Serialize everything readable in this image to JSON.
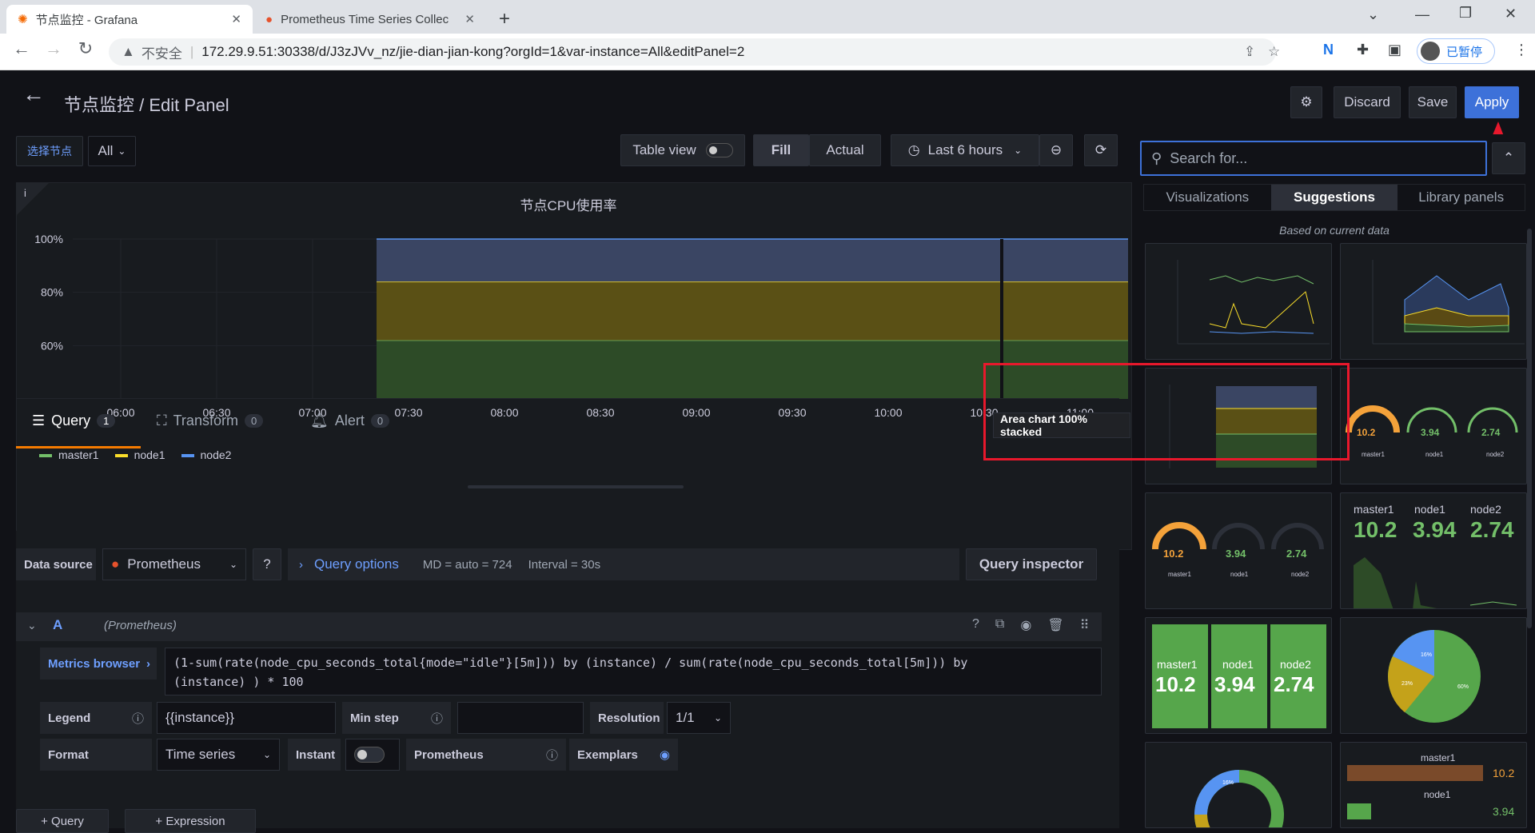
{
  "browser": {
    "tabs": [
      {
        "title": "节点监控 - Grafana"
      },
      {
        "title": "Prometheus Time Series Collec"
      }
    ],
    "security_label": "不安全",
    "url": "172.29.9.51:30338/d/J3zJVv_nz/jie-dian-jian-kong?orgId=1&var-instance=All&editPanel=2",
    "profile_label": "已暂停"
  },
  "header": {
    "title": "节点监控 / Edit Panel",
    "discard": "Discard",
    "save": "Save",
    "apply": "Apply"
  },
  "toolbar": {
    "variable_label": "选择节点",
    "variable_value": "All",
    "table_view": "Table view",
    "fill": "Fill",
    "actual": "Actual",
    "time_range": "Last 6 hours"
  },
  "panel": {
    "info": "i",
    "title": "节点CPU使用率"
  },
  "chart_data": {
    "type": "area",
    "stacking": "100%",
    "x_ticks": [
      "06:00",
      "06:30",
      "07:00",
      "07:30",
      "08:00",
      "08:30",
      "09:00",
      "09:30",
      "10:00",
      "10:30",
      "11:00"
    ],
    "y_ticks": [
      "60%",
      "80%",
      "100%"
    ],
    "ylim": [
      40,
      100
    ],
    "series": [
      {
        "name": "master1",
        "color": "#73bf69",
        "band": [
          40,
          62
        ]
      },
      {
        "name": "node1",
        "color": "#fade2a",
        "band": [
          62,
          84
        ]
      },
      {
        "name": "node2",
        "color": "#5794f2",
        "band": [
          84,
          100
        ]
      }
    ],
    "data_start": "07:20",
    "data_end": "11:20",
    "legend_position": "bottom-left"
  },
  "query_tabs": [
    {
      "label": "Query",
      "count": "1"
    },
    {
      "label": "Transform",
      "count": "0"
    },
    {
      "label": "Alert",
      "count": "0"
    }
  ],
  "query": {
    "datasource_label": "Data source",
    "datasource": "Prometheus",
    "options_label": "Query options",
    "md": "MD = auto = 724",
    "interval": "Interval = 30s",
    "inspector": "Query inspector",
    "ref": "A",
    "ref_ds": "(Prometheus)",
    "metrics_browser": "Metrics browser",
    "expr_line1": "(1-sum(rate(node_cpu_seconds_total{mode=\"idle\"}[5m])) by (instance) / sum(rate(node_cpu_seconds_total[5m])) by",
    "expr_line2": "(instance) ) * 100",
    "legend_label": "Legend",
    "legend_value": "{{instance}}",
    "minstep_label": "Min step",
    "resolution_label": "Resolution",
    "resolution_value": "1/1",
    "format_label": "Format",
    "format_value": "Time series",
    "instant_label": "Instant",
    "prom_label": "Prometheus",
    "exemplars_label": "Exemplars",
    "add_query": "+ Query",
    "add_expr": "+ Expression"
  },
  "viz": {
    "search_placeholder": "Search for...",
    "tabs": [
      "Visualizations",
      "Suggestions",
      "Library panels"
    ],
    "subtitle": "Based on current data",
    "tooltip": "Area chart 100% stacked",
    "values": {
      "master1": "10.2",
      "node1": "3.94",
      "node2": "2.74"
    },
    "names": {
      "master1": "master1",
      "node1": "node1",
      "node2": "node2"
    },
    "pie": [
      "16%",
      "23%",
      "60%"
    ]
  }
}
